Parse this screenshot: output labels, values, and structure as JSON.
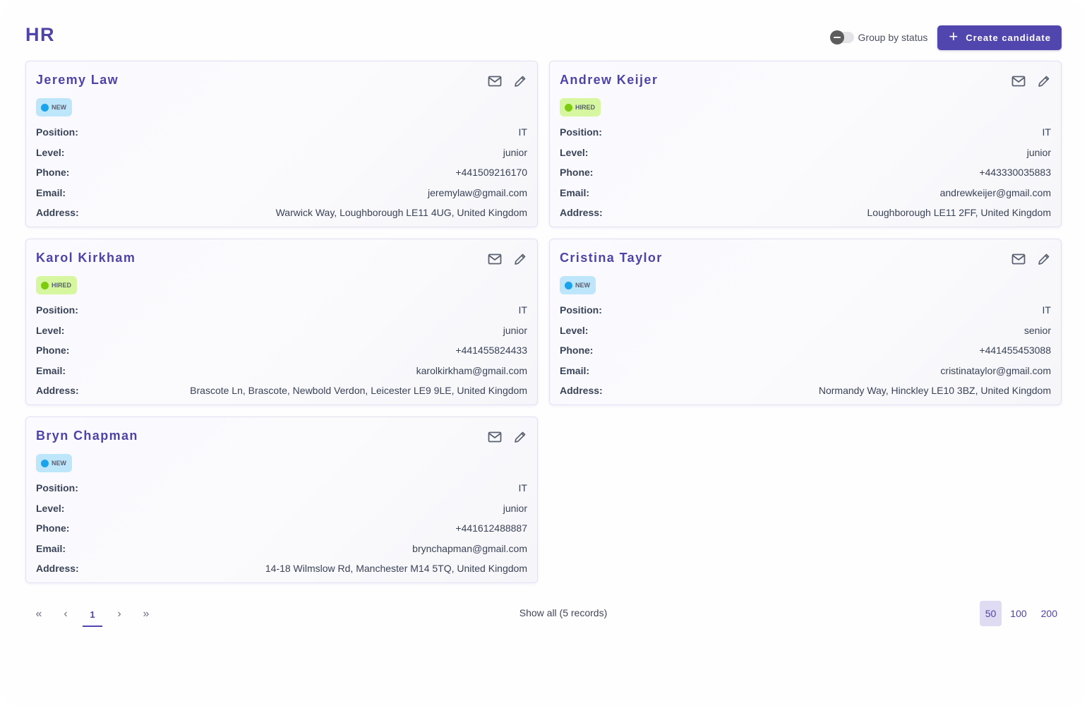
{
  "page": {
    "title": "HR"
  },
  "toolbar": {
    "group_toggle_label": "Group by status",
    "group_toggle_on": false,
    "create_label": "Create candidate"
  },
  "field_labels": {
    "position": "Position:",
    "level": "Level:",
    "phone": "Phone:",
    "email": "Email:",
    "address": "Address:"
  },
  "icons": {
    "email": "mail-icon",
    "edit": "pencil-icon"
  },
  "status_colors": {
    "new": "#1aa2ea",
    "hired": "#7ccb10"
  },
  "candidates": [
    {
      "name": "Jeremy Law",
      "status": "NEW",
      "status_key": "new",
      "position": "IT",
      "level": "junior",
      "phone": "+441509216170",
      "email": "jeremylaw@gmail.com",
      "address": "Warwick Way, Loughborough LE11 4UG, United Kingdom"
    },
    {
      "name": "Andrew Keijer",
      "status": "HIRED",
      "status_key": "hired",
      "position": "IT",
      "level": "junior",
      "phone": "+443330035883",
      "email": "andrewkeijer@gmail.com",
      "address": "Loughborough LE11 2FF, United Kingdom"
    },
    {
      "name": "Karol Kirkham",
      "status": "HIRED",
      "status_key": "hired",
      "position": "IT",
      "level": "junior",
      "phone": "+441455824433",
      "email": "karolkirkham@gmail.com",
      "address": "Brascote Ln, Brascote, Newbold Verdon, Leicester LE9 9LE, United Kingdom"
    },
    {
      "name": "Cristina Taylor",
      "status": "NEW",
      "status_key": "new",
      "position": "IT",
      "level": "senior",
      "phone": "+441455453088",
      "email": "cristinataylor@gmail.com",
      "address": "Normandy Way, Hinckley LE10 3BZ, United Kingdom"
    },
    {
      "name": "Bryn Chapman",
      "status": "NEW",
      "status_key": "new",
      "position": "IT",
      "level": "junior",
      "phone": "+441612488887",
      "email": "brynchapman@gmail.com",
      "address": "14-18 Wilmslow Rd, Manchester M14 5TQ, United Kingdom"
    }
  ],
  "pagination": {
    "first": "«",
    "prev": "‹",
    "current_page": "1",
    "next": "›",
    "last": "»",
    "records_text": "Show all (5 records)",
    "page_sizes": [
      "50",
      "100",
      "200"
    ],
    "selected_page_size": "50"
  }
}
